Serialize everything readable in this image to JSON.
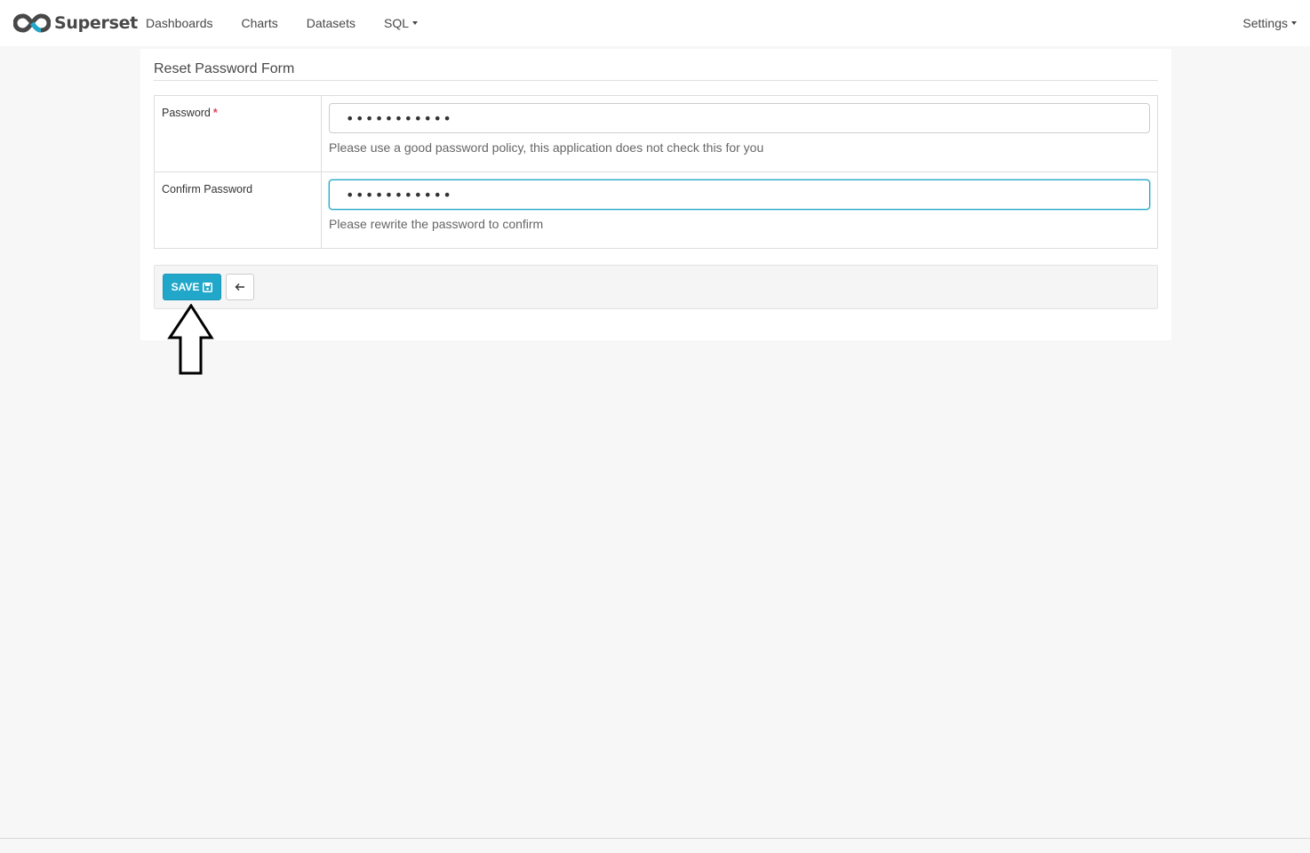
{
  "navbar": {
    "brand": "Superset",
    "links": [
      "Dashboards",
      "Charts",
      "Datasets",
      "SQL"
    ],
    "settings_label": "Settings"
  },
  "form": {
    "title": "Reset Password Form",
    "password": {
      "label": "Password",
      "required_mark": "*",
      "value": "•••••••••••",
      "help": "Please use a good password policy, this application does not check this for you"
    },
    "confirm": {
      "label": "Confirm Password",
      "value": "•••••••••••",
      "help": "Please rewrite the password to confirm"
    },
    "save_label": "SAVE"
  },
  "colors": {
    "accent": "#20a7c9",
    "required": "#e04355"
  },
  "icons": {
    "logo": "superset-logo-icon",
    "save": "floppy-disk-icon",
    "back": "arrow-left-icon",
    "annotation": "up-arrow-annotation"
  }
}
